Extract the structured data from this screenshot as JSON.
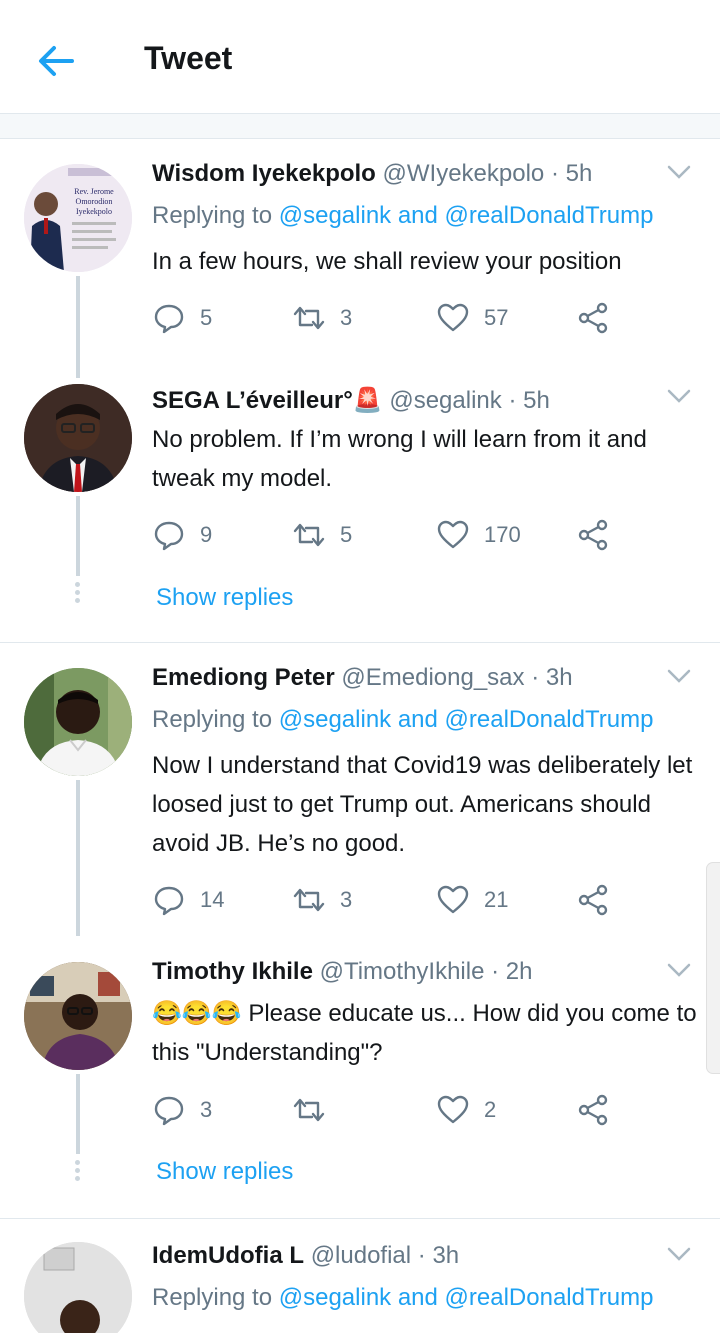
{
  "header": {
    "title": "Tweet"
  },
  "tweets": [
    {
      "name": "Wisdom Iyekekpolo",
      "handle": "@WIyekekpolo",
      "time": "5h",
      "replying_prefix": "Replying to",
      "replying_to": "@segalink and @realDonaldTrump",
      "text": "In a few hours, we shall review your position",
      "replies": "5",
      "retweets": "3",
      "likes": "57",
      "avatar_text": [
        "Rev. Jerome",
        "Omorodion",
        "Iyekekpolo"
      ]
    },
    {
      "name": "SEGA L’éveilleur°🚨",
      "handle": "@segalink",
      "time": "5h",
      "text": "No problem. If I’m wrong I will learn from it and tweak my model.",
      "replies": "9",
      "retweets": "5",
      "likes": "170",
      "show_replies": "Show replies"
    },
    {
      "name": "Emediong Peter",
      "handle": "@Emediong_sax",
      "time": "3h",
      "replying_prefix": "Replying to",
      "replying_to": "@segalink and @realDonaldTrump",
      "text": "Now I understand that Covid19 was deliberately let loosed just to get Trump out. Americans should avoid JB. He’s no good.",
      "replies": "14",
      "retweets": "3",
      "likes": "21"
    },
    {
      "name": "Timothy Ikhile",
      "handle": "@TimothyIkhile",
      "time": "2h",
      "emoji": "😂😂😂",
      "text": "Please educate us... How did you come to this \"Understanding\"?",
      "replies": "3",
      "retweets": "",
      "likes": "2",
      "show_replies": "Show replies"
    },
    {
      "name": "IdemUdofia L",
      "handle": "@ludofial",
      "time": "3h",
      "replying_prefix": "Replying to",
      "replying_to": "@segalink and @realDonaldTrump"
    }
  ],
  "separator": "·",
  "colors": {
    "accent": "#1da1f2",
    "secondary": "#657786",
    "text": "#14171a",
    "line": "#ccd6dd"
  }
}
